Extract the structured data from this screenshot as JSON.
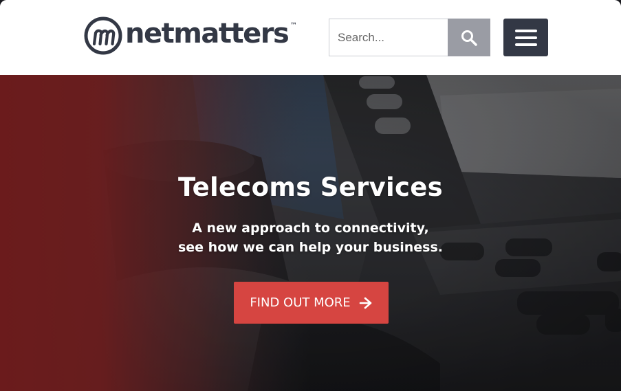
{
  "header": {
    "brand_name": "netmatters",
    "brand_tm": "™",
    "search_placeholder": "Search...",
    "search_value": ""
  },
  "hero": {
    "title": "Telecoms Services",
    "subtitle_line1": "A new approach to connectivity,",
    "subtitle_line2": "see how we can help your business.",
    "cta_label": "FIND OUT MORE"
  },
  "colors": {
    "brand_dark": "#333845",
    "search_button": "#9a9ca4",
    "cta": "#d64541",
    "hero_red_overlay": "#7a1f20"
  },
  "icons": [
    "logo-mark-icon",
    "search-icon",
    "menu-icon",
    "arrow-right-icon"
  ]
}
